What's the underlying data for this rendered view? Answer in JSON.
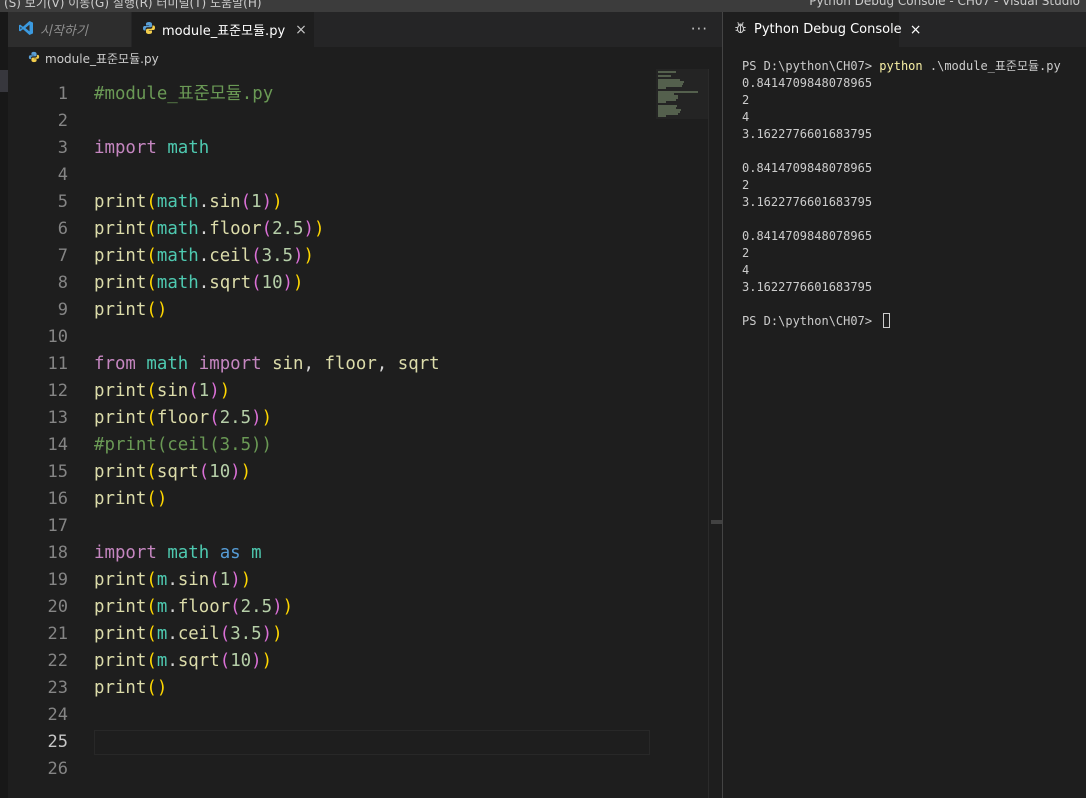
{
  "window": {
    "menu_text": "(S)   보기(V)   이동(G)   실행(R)   터미널(T)   도움말(H)",
    "title": "Python Debug Console - CH07 - Visual Studio"
  },
  "tabs": {
    "welcome_label": "시작하기",
    "module_label": "module_표준모듈.py",
    "close_glyph": "×",
    "more_glyph": "···"
  },
  "breadcrumb": {
    "file": "module_표준모듈.py"
  },
  "editor": {
    "active_line": 25,
    "line_numbers": [
      "1",
      "2",
      "3",
      "4",
      "5",
      "6",
      "7",
      "8",
      "9",
      "10",
      "11",
      "12",
      "13",
      "14",
      "15",
      "16",
      "17",
      "18",
      "19",
      "20",
      "21",
      "22",
      "23",
      "24",
      "25",
      "26"
    ],
    "lines": [
      [
        {
          "t": "#module_표준모듈.py",
          "c": "cm"
        }
      ],
      [],
      [
        {
          "t": "import",
          "c": "kw"
        },
        {
          "t": " "
        },
        {
          "t": "math",
          "c": "mod"
        }
      ],
      [],
      [
        {
          "t": "print",
          "c": "fn"
        },
        {
          "t": "(",
          "c": "p1"
        },
        {
          "t": "math",
          "c": "mod"
        },
        {
          "t": "."
        },
        {
          "t": "sin",
          "c": "fn"
        },
        {
          "t": "(",
          "c": "p2"
        },
        {
          "t": "1",
          "c": "num"
        },
        {
          "t": ")",
          "c": "p2"
        },
        {
          "t": ")",
          "c": "p1"
        }
      ],
      [
        {
          "t": "print",
          "c": "fn"
        },
        {
          "t": "(",
          "c": "p1"
        },
        {
          "t": "math",
          "c": "mod"
        },
        {
          "t": "."
        },
        {
          "t": "floor",
          "c": "fn"
        },
        {
          "t": "(",
          "c": "p2"
        },
        {
          "t": "2.5",
          "c": "num"
        },
        {
          "t": ")",
          "c": "p2"
        },
        {
          "t": ")",
          "c": "p1"
        }
      ],
      [
        {
          "t": "print",
          "c": "fn"
        },
        {
          "t": "(",
          "c": "p1"
        },
        {
          "t": "math",
          "c": "mod"
        },
        {
          "t": "."
        },
        {
          "t": "ceil",
          "c": "fn"
        },
        {
          "t": "(",
          "c": "p2"
        },
        {
          "t": "3.5",
          "c": "num"
        },
        {
          "t": ")",
          "c": "p2"
        },
        {
          "t": ")",
          "c": "p1"
        }
      ],
      [
        {
          "t": "print",
          "c": "fn"
        },
        {
          "t": "(",
          "c": "p1"
        },
        {
          "t": "math",
          "c": "mod"
        },
        {
          "t": "."
        },
        {
          "t": "sqrt",
          "c": "fn"
        },
        {
          "t": "(",
          "c": "p2"
        },
        {
          "t": "10",
          "c": "num"
        },
        {
          "t": ")",
          "c": "p2"
        },
        {
          "t": ")",
          "c": "p1"
        }
      ],
      [
        {
          "t": "print",
          "c": "fn"
        },
        {
          "t": "()",
          "c": "p1"
        }
      ],
      [],
      [
        {
          "t": "from",
          "c": "kw"
        },
        {
          "t": " "
        },
        {
          "t": "math",
          "c": "mod"
        },
        {
          "t": " "
        },
        {
          "t": "import",
          "c": "kw"
        },
        {
          "t": " "
        },
        {
          "t": "sin",
          "c": "fn"
        },
        {
          "t": ", "
        },
        {
          "t": "floor",
          "c": "fn"
        },
        {
          "t": ", "
        },
        {
          "t": "sqrt",
          "c": "fn"
        }
      ],
      [
        {
          "t": "print",
          "c": "fn"
        },
        {
          "t": "(",
          "c": "p1"
        },
        {
          "t": "sin",
          "c": "fn"
        },
        {
          "t": "(",
          "c": "p2"
        },
        {
          "t": "1",
          "c": "num"
        },
        {
          "t": ")",
          "c": "p2"
        },
        {
          "t": ")",
          "c": "p1"
        }
      ],
      [
        {
          "t": "print",
          "c": "fn"
        },
        {
          "t": "(",
          "c": "p1"
        },
        {
          "t": "floor",
          "c": "fn"
        },
        {
          "t": "(",
          "c": "p2"
        },
        {
          "t": "2.5",
          "c": "num"
        },
        {
          "t": ")",
          "c": "p2"
        },
        {
          "t": ")",
          "c": "p1"
        }
      ],
      [
        {
          "t": "#print(ceil(3.5))",
          "c": "cm"
        }
      ],
      [
        {
          "t": "print",
          "c": "fn"
        },
        {
          "t": "(",
          "c": "p1"
        },
        {
          "t": "sqrt",
          "c": "fn"
        },
        {
          "t": "(",
          "c": "p2"
        },
        {
          "t": "10",
          "c": "num"
        },
        {
          "t": ")",
          "c": "p2"
        },
        {
          "t": ")",
          "c": "p1"
        }
      ],
      [
        {
          "t": "print",
          "c": "fn"
        },
        {
          "t": "()",
          "c": "p1"
        }
      ],
      [],
      [
        {
          "t": "import",
          "c": "kw"
        },
        {
          "t": " "
        },
        {
          "t": "math",
          "c": "mod"
        },
        {
          "t": " "
        },
        {
          "t": "as",
          "c": "as"
        },
        {
          "t": " "
        },
        {
          "t": "m",
          "c": "mod"
        }
      ],
      [
        {
          "t": "print",
          "c": "fn"
        },
        {
          "t": "(",
          "c": "p1"
        },
        {
          "t": "m",
          "c": "mod"
        },
        {
          "t": "."
        },
        {
          "t": "sin",
          "c": "fn"
        },
        {
          "t": "(",
          "c": "p2"
        },
        {
          "t": "1",
          "c": "num"
        },
        {
          "t": ")",
          "c": "p2"
        },
        {
          "t": ")",
          "c": "p1"
        }
      ],
      [
        {
          "t": "print",
          "c": "fn"
        },
        {
          "t": "(",
          "c": "p1"
        },
        {
          "t": "m",
          "c": "mod"
        },
        {
          "t": "."
        },
        {
          "t": "floor",
          "c": "fn"
        },
        {
          "t": "(",
          "c": "p2"
        },
        {
          "t": "2.5",
          "c": "num"
        },
        {
          "t": ")",
          "c": "p2"
        },
        {
          "t": ")",
          "c": "p1"
        }
      ],
      [
        {
          "t": "print",
          "c": "fn"
        },
        {
          "t": "(",
          "c": "p1"
        },
        {
          "t": "m",
          "c": "mod"
        },
        {
          "t": "."
        },
        {
          "t": "ceil",
          "c": "fn"
        },
        {
          "t": "(",
          "c": "p2"
        },
        {
          "t": "3.5",
          "c": "num"
        },
        {
          "t": ")",
          "c": "p2"
        },
        {
          "t": ")",
          "c": "p1"
        }
      ],
      [
        {
          "t": "print",
          "c": "fn"
        },
        {
          "t": "(",
          "c": "p1"
        },
        {
          "t": "m",
          "c": "mod"
        },
        {
          "t": "."
        },
        {
          "t": "sqrt",
          "c": "fn"
        },
        {
          "t": "(",
          "c": "p2"
        },
        {
          "t": "10",
          "c": "num"
        },
        {
          "t": ")",
          "c": "p2"
        },
        {
          "t": ")",
          "c": "p1"
        }
      ],
      [
        {
          "t": "print",
          "c": "fn"
        },
        {
          "t": "()",
          "c": "p1"
        }
      ],
      [],
      [],
      []
    ]
  },
  "panel": {
    "tab_label": "Python Debug Console",
    "close_glyph": "×",
    "terminal": [
      {
        "prompt": "PS D:\\python\\CH07> ",
        "cmd": "python",
        "args": " .\\module_표준모듈.py"
      },
      {
        "text": "0.8414709848078965"
      },
      {
        "text": "2"
      },
      {
        "text": "4"
      },
      {
        "text": "3.1622776601683795"
      },
      {
        "text": ""
      },
      {
        "text": "0.8414709848078965"
      },
      {
        "text": "2"
      },
      {
        "text": "3.1622776601683795"
      },
      {
        "text": ""
      },
      {
        "text": "0.8414709848078965"
      },
      {
        "text": "2"
      },
      {
        "text": "4"
      },
      {
        "text": "3.1622776601683795"
      },
      {
        "text": ""
      },
      {
        "prompt": "PS D:\\python\\CH07> ",
        "cursor": true
      }
    ]
  },
  "icons": {
    "vscode": "vscode-logo-icon",
    "python": "python-file-icon",
    "debug": "bug-icon"
  },
  "colors": {
    "background": "#1e1e1e",
    "comment": "#6a9955",
    "keyword": "#c586c0",
    "function": "#dcdcaa",
    "module": "#4ec9b0",
    "number": "#b5cea8",
    "bracket1": "#ffd700",
    "bracket2": "#da70d6",
    "terminal_command": "#f9f1a5"
  }
}
